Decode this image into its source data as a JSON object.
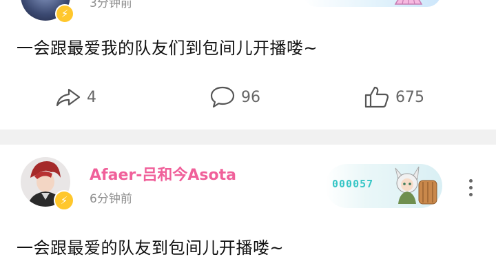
{
  "post1": {
    "timestamp": "3分钟前",
    "text": "一会跟最爱我的队友们到包间儿开播喽~",
    "share_count": "4",
    "comment_count": "96",
    "like_count": "675"
  },
  "post2": {
    "username": "Afaer-吕和今Asota",
    "timestamp": "6分钟前",
    "text": "一会跟最爱的队友到包间儿开播喽~",
    "medal_number": "000057"
  },
  "icons": {
    "badge": "lightning-icon",
    "share": "share-arrow-icon",
    "comment": "comment-bubble-icon",
    "like": "thumbs-up-icon",
    "more": "more-vertical-icon"
  },
  "colors": {
    "username": "#f0609a",
    "badge": "#ffc72c",
    "medal_text": "#38c6c6",
    "divider": "#f1f1f1"
  }
}
